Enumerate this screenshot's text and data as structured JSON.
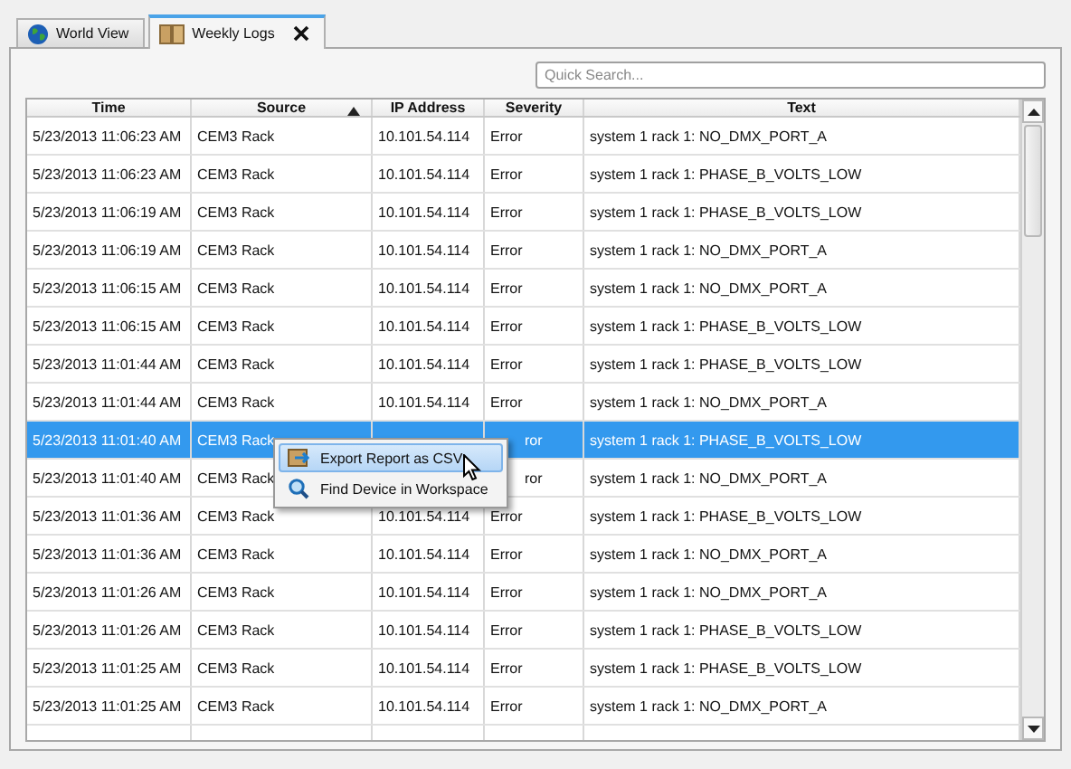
{
  "tabs": [
    {
      "label": "World View",
      "selected": false,
      "closable": false
    },
    {
      "label": "Weekly Logs",
      "selected": true,
      "closable": true
    }
  ],
  "search": {
    "placeholder": "Quick Search..."
  },
  "table": {
    "columns": [
      {
        "label": "Time",
        "sorted": false
      },
      {
        "label": "Source",
        "sorted": true
      },
      {
        "label": "IP Address",
        "sorted": false
      },
      {
        "label": "Severity",
        "sorted": false
      },
      {
        "label": "Text",
        "sorted": false
      }
    ],
    "rows": [
      {
        "time": "5/23/2013 11:06:23 AM",
        "source": "CEM3 Rack",
        "ip": "10.101.54.114",
        "severity": "Error",
        "text": "system 1 rack 1: NO_DMX_PORT_A",
        "selected": false
      },
      {
        "time": "5/23/2013 11:06:23 AM",
        "source": "CEM3 Rack",
        "ip": "10.101.54.114",
        "severity": "Error",
        "text": "system 1 rack 1: PHASE_B_VOLTS_LOW",
        "selected": false
      },
      {
        "time": "5/23/2013 11:06:19 AM",
        "source": "CEM3 Rack",
        "ip": "10.101.54.114",
        "severity": "Error",
        "text": "system 1 rack 1: PHASE_B_VOLTS_LOW",
        "selected": false
      },
      {
        "time": "5/23/2013 11:06:19 AM",
        "source": "CEM3 Rack",
        "ip": "10.101.54.114",
        "severity": "Error",
        "text": "system 1 rack 1: NO_DMX_PORT_A",
        "selected": false
      },
      {
        "time": "5/23/2013 11:06:15 AM",
        "source": "CEM3 Rack",
        "ip": "10.101.54.114",
        "severity": "Error",
        "text": "system 1 rack 1: NO_DMX_PORT_A",
        "selected": false
      },
      {
        "time": "5/23/2013 11:06:15 AM",
        "source": "CEM3 Rack",
        "ip": "10.101.54.114",
        "severity": "Error",
        "text": "system 1 rack 1: PHASE_B_VOLTS_LOW",
        "selected": false
      },
      {
        "time": "5/23/2013 11:01:44 AM",
        "source": "CEM3 Rack",
        "ip": "10.101.54.114",
        "severity": "Error",
        "text": "system 1 rack 1: PHASE_B_VOLTS_LOW",
        "selected": false
      },
      {
        "time": "5/23/2013 11:01:44 AM",
        "source": "CEM3 Rack",
        "ip": "10.101.54.114",
        "severity": "Error",
        "text": "system 1 rack 1: NO_DMX_PORT_A",
        "selected": false
      },
      {
        "time": "5/23/2013 11:01:40 AM",
        "source": "CEM3 Rack",
        "severity": "ror",
        "text": "system 1 rack 1: PHASE_B_VOLTS_LOW",
        "selected": true
      },
      {
        "time": "5/23/2013 11:01:40 AM",
        "source": "CEM3 Rack",
        "severity": "ror",
        "text": "system 1 rack 1: NO_DMX_PORT_A",
        "selected": false
      },
      {
        "time": "5/23/2013 11:01:36 AM",
        "source": "CEM3 Rack",
        "ip": "10.101.54.114",
        "severity": "Error",
        "text": "system 1 rack 1: PHASE_B_VOLTS_LOW",
        "selected": false
      },
      {
        "time": "5/23/2013 11:01:36 AM",
        "source": "CEM3 Rack",
        "ip": "10.101.54.114",
        "severity": "Error",
        "text": "system 1 rack 1: NO_DMX_PORT_A",
        "selected": false
      },
      {
        "time": "5/23/2013 11:01:26 AM",
        "source": "CEM3 Rack",
        "ip": "10.101.54.114",
        "severity": "Error",
        "text": "system 1 rack 1: NO_DMX_PORT_A",
        "selected": false
      },
      {
        "time": "5/23/2013 11:01:26 AM",
        "source": "CEM3 Rack",
        "ip": "10.101.54.114",
        "severity": "Error",
        "text": "system 1 rack 1: PHASE_B_VOLTS_LOW",
        "selected": false
      },
      {
        "time": "5/23/2013 11:01:25 AM",
        "source": "CEM3 Rack",
        "ip": "10.101.54.114",
        "severity": "Error",
        "text": "system 1 rack 1: PHASE_B_VOLTS_LOW",
        "selected": false
      },
      {
        "time": "5/23/2013 11:01:25 AM",
        "source": "CEM3 Rack",
        "ip": "10.101.54.114",
        "severity": "Error",
        "text": "system 1 rack 1: NO_DMX_PORT_A",
        "selected": false
      }
    ]
  },
  "context_menu": {
    "items": [
      {
        "label": "Export Report as CSV",
        "selected": true
      },
      {
        "label": "Find Device in Workspace",
        "selected": false
      }
    ]
  }
}
